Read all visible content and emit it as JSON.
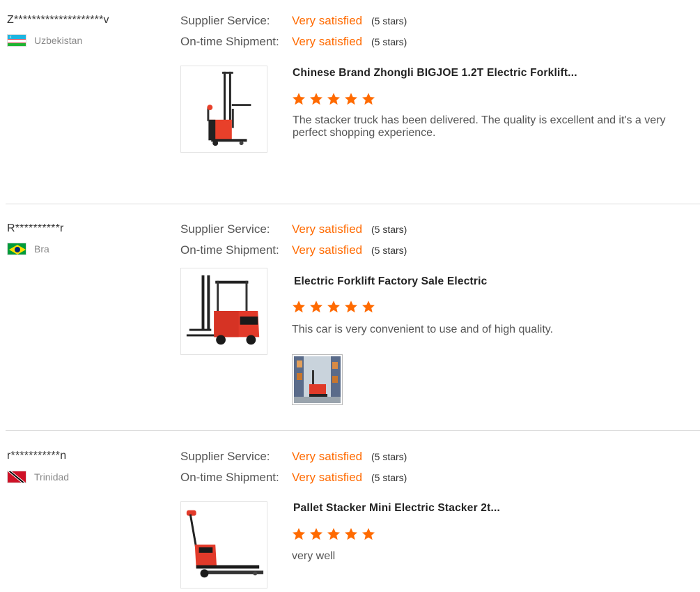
{
  "reviews": [
    {
      "buyer": "Z********************v",
      "country": "Uzbekistan",
      "flag": "uzbekistan-flag",
      "supplier_label": "Supplier Service:",
      "supplier_value": "Very satisfied",
      "supplier_stars": "(5 stars)",
      "shipment_label": "On-time Shipment:",
      "shipment_value": "Very satisfied",
      "shipment_stars": "(5 stars)",
      "product_title": "Chinese Brand Zhongli BIGJOE 1.2T Electric Forklift...",
      "rating": 5,
      "comment": "The stacker truck has been delivered. The quality is excellent and it's a very perfect shopping experience."
    },
    {
      "buyer": "R**********r",
      "country": "Bra",
      "flag": "brazil-flag",
      "supplier_label": "Supplier Service:",
      "supplier_value": "Very satisfied",
      "supplier_stars": "(5 stars)",
      "shipment_label": "On-time Shipment:",
      "shipment_value": "Very satisfied",
      "shipment_stars": "(5 stars)",
      "product_title": "Electric Forklift Factory Sale Electric",
      "rating": 5,
      "comment": "This car is very convenient to use and of high quality."
    },
    {
      "buyer": "r***********n",
      "country": "Trinidad",
      "flag": "trinidad-flag",
      "supplier_label": "Supplier Service:",
      "supplier_value": "Very satisfied",
      "supplier_stars": "(5 stars)",
      "shipment_label": "On-time Shipment:",
      "shipment_value": "Very satisfied",
      "shipment_stars": "(5 stars)",
      "product_title": "Pallet Stacker Mini Electric Stacker 2t...",
      "rating": 5,
      "comment": "very well"
    }
  ],
  "colors": {
    "accent": "#ff6a00",
    "star": "#ff6a00",
    "label": "#555555",
    "divider": "#dcdcdc"
  }
}
